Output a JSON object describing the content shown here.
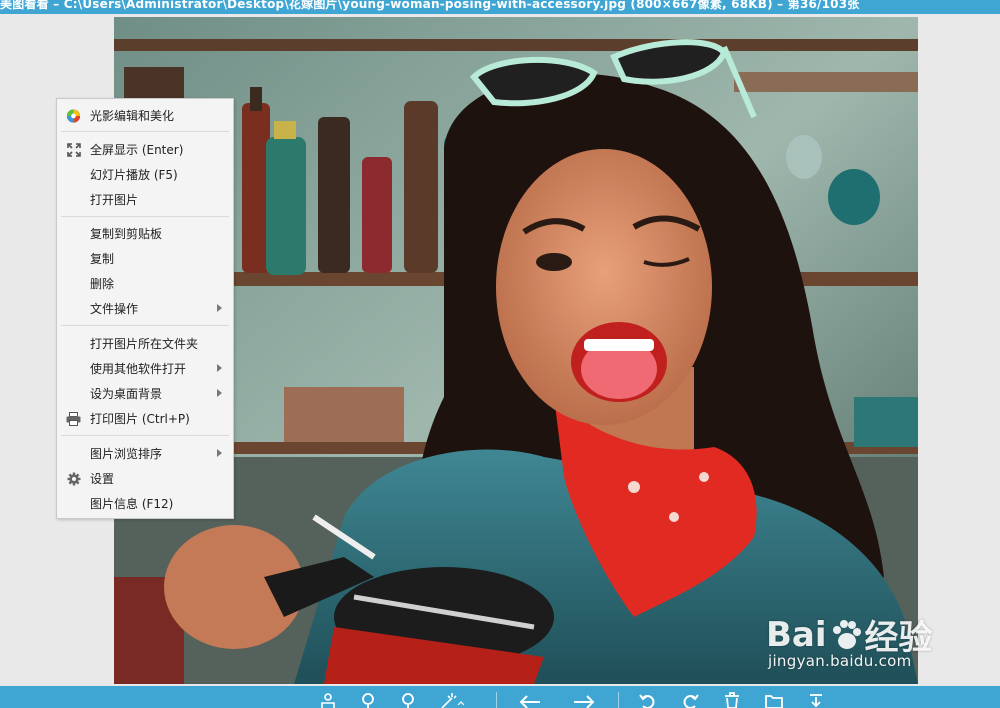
{
  "titlebar": {
    "title": "美图看看 – C:\\Users\\Administrator\\Desktop\\花嫁图片\\young-woman-posing-with-accessory.jpg (800×667像素, 68KB) – 第36/103张"
  },
  "menu": {
    "items": [
      {
        "label": "光影编辑和美化",
        "icon": "color-wheel-icon",
        "submenu": false
      },
      {
        "label": "全屏显示 (Enter)",
        "icon": "fullscreen-icon",
        "submenu": false
      },
      {
        "label": "幻灯片播放 (F5)",
        "icon": "",
        "submenu": false
      },
      {
        "label": "打开图片",
        "icon": "",
        "submenu": false
      },
      {
        "label": "复制到剪贴板",
        "icon": "",
        "submenu": false
      },
      {
        "label": "复制",
        "icon": "",
        "submenu": false
      },
      {
        "label": "删除",
        "icon": "",
        "submenu": false
      },
      {
        "label": "文件操作",
        "icon": "",
        "submenu": true
      },
      {
        "label": "打开图片所在文件夹",
        "icon": "",
        "submenu": false
      },
      {
        "label": "使用其他软件打开",
        "icon": "",
        "submenu": true
      },
      {
        "label": "设为桌面背景",
        "icon": "",
        "submenu": true
      },
      {
        "label": "打印图片 (Ctrl+P)",
        "icon": "printer-icon",
        "submenu": false
      },
      {
        "label": "图片浏览排序",
        "icon": "",
        "submenu": true
      },
      {
        "label": "设置",
        "icon": "gear-icon",
        "submenu": false
      },
      {
        "label": "图片信息 (F12)",
        "icon": "",
        "submenu": false
      }
    ]
  },
  "watermark": {
    "logo": "Bai  经验",
    "site": "jingyan.baidu.com"
  },
  "toolbar": {
    "icons": [
      "rotate-person-icon",
      "zoom-in-icon",
      "zoom-out-icon",
      "magic-wand-icon",
      "prev-arrow-icon",
      "next-arrow-icon",
      "rotate-left-icon",
      "rotate-right-icon",
      "delete-icon",
      "folder-icon",
      "save-icon"
    ]
  },
  "colors": {
    "accent": "#3fa6d4",
    "menu_bg": "#f4f4f4",
    "menu_text": "#222222"
  }
}
